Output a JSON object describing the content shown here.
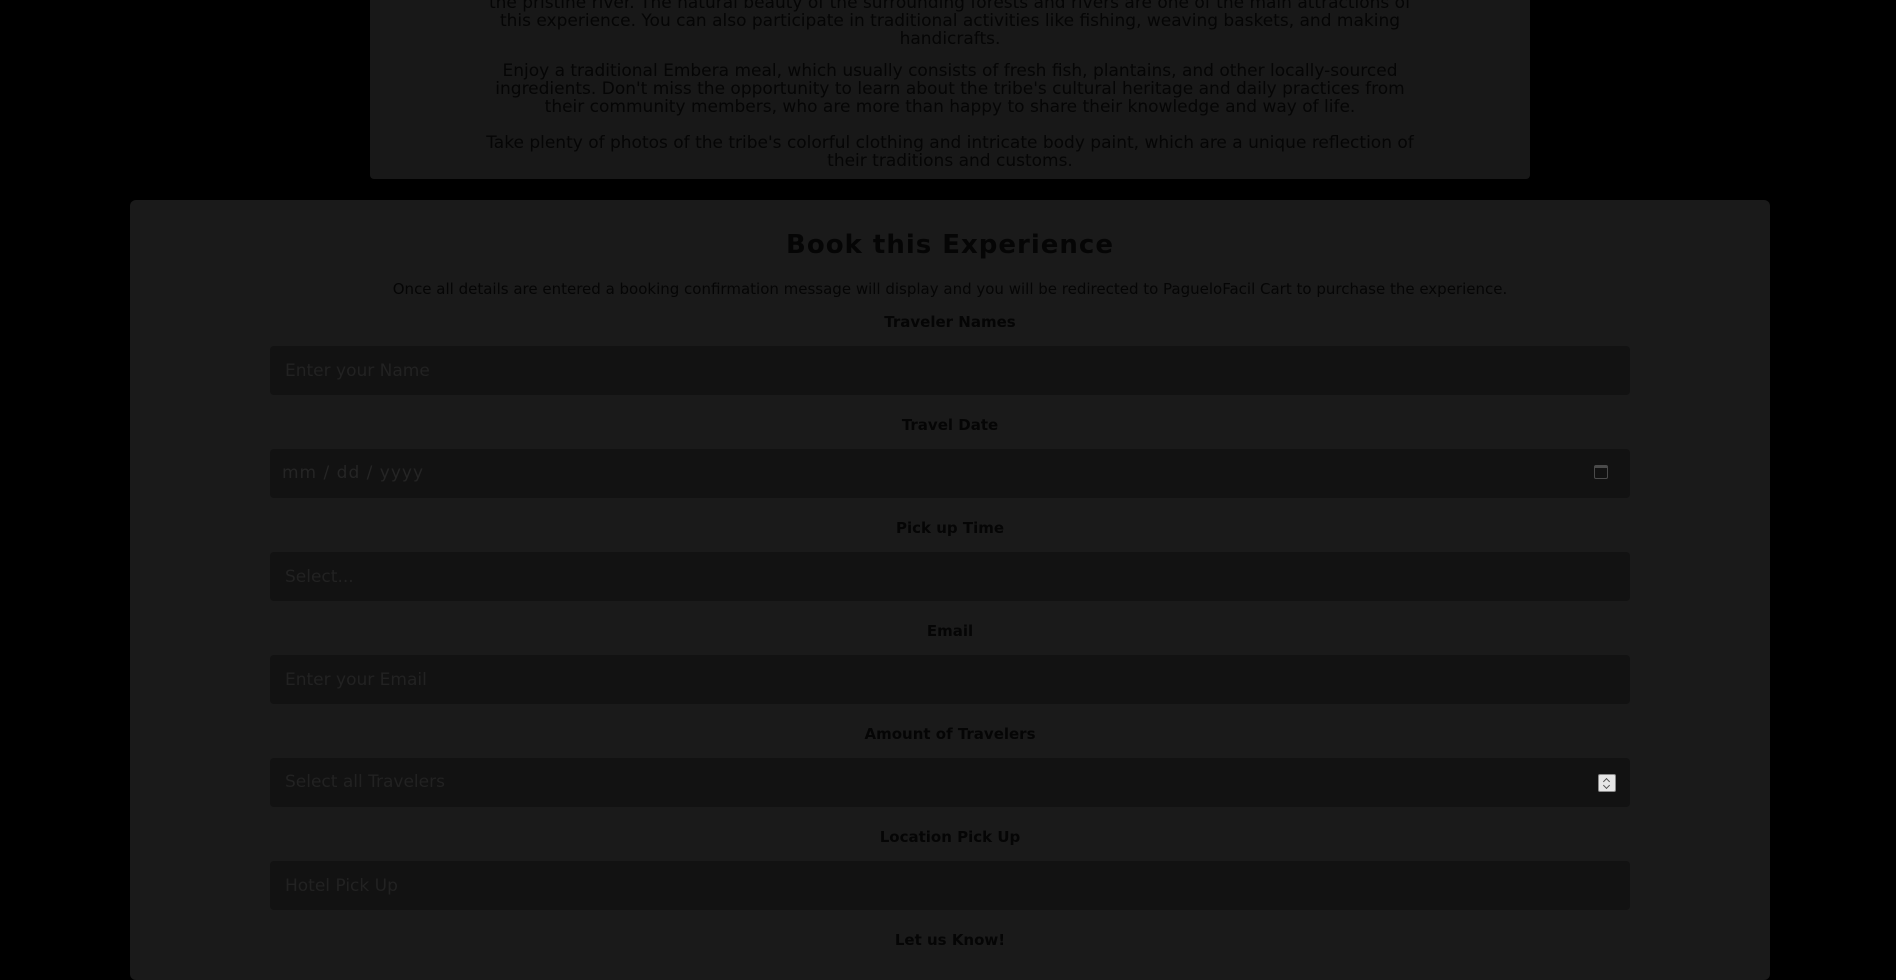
{
  "description": {
    "line0": "the pristine river. The natural beauty of the surrounding forests and rivers are one of the main attractions of this experience. You can also participate in traditional activities like fishing, weaving baskets, and making handicrafts.",
    "paragraph2": "Enjoy a traditional Embera meal, which usually consists of fresh fish, plantains, and other locally-sourced ingredients. Don't miss the opportunity to learn about the tribe's cultural heritage and daily practices from their community members, who are more than happy to share their knowledge and way of life.",
    "paragraph3": "Take plenty of photos of the tribe's colorful clothing and intricate body paint, which are a unique reflection of their traditions and customs."
  },
  "booking": {
    "title": "Book this Experience",
    "subtitle": "Once all details are entered a booking confirmation message will display and you will be redirected to PagueloFacil Cart to purchase the experience.",
    "fields": {
      "names": {
        "label": "Traveler Names",
        "placeholder": "Enter your Name"
      },
      "date": {
        "label": "Travel Date",
        "value": "mm / dd / yyyy"
      },
      "time": {
        "label": "Pick up Time",
        "placeholder": "Select..."
      },
      "email": {
        "label": "Email",
        "placeholder": "Enter your Email"
      },
      "travelers": {
        "label": "Amount of Travelers",
        "value": "Select all Travelers"
      },
      "location": {
        "label": "Location Pick Up",
        "placeholder": "Hotel Pick Up"
      },
      "notes": {
        "label": "Let us Know!"
      }
    }
  },
  "icons": {
    "date": "calendar-icon",
    "travelers": "up-down-arrows-icon"
  },
  "colors": {
    "page_bg": "#000000",
    "card_bg": "#181818",
    "form_bg": "#1a1a1a",
    "field_bg": "#121212",
    "text": "#050505"
  }
}
